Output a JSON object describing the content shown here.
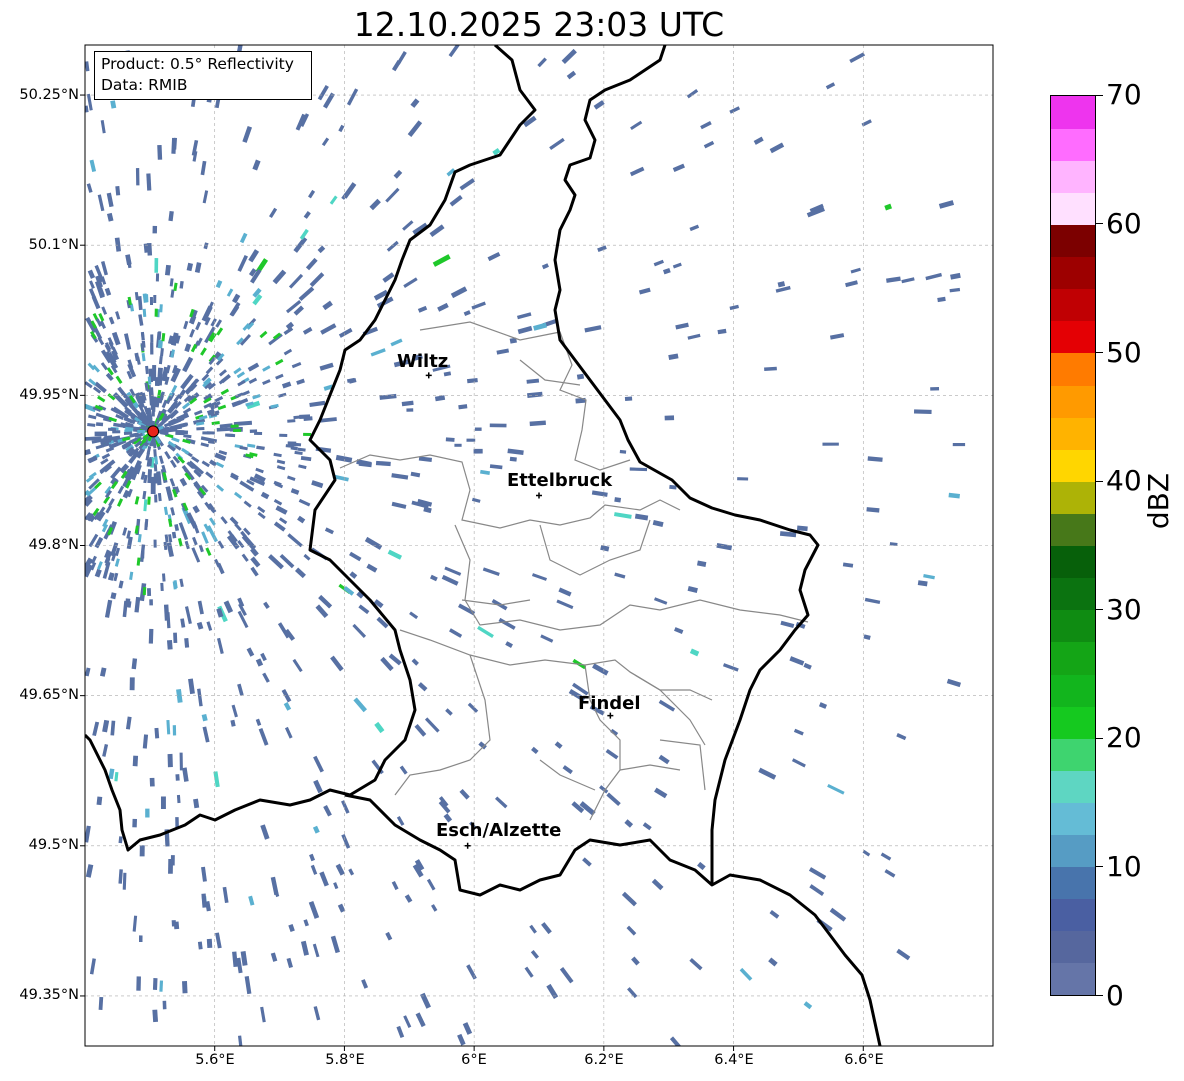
{
  "title": "12.10.2025 23:03 UTC",
  "info_box": {
    "product": "Product: 0.5° Reflectivity",
    "data": "Data: RMIB"
  },
  "lat_labels": [
    "50.25°N",
    "50.1°N",
    "49.95°N",
    "49.8°N",
    "49.65°N",
    "49.5°N",
    "49.35°N"
  ],
  "lon_labels": [
    "5.6°E",
    "5.8°E",
    "6°E",
    "6.2°E",
    "6.4°E",
    "6.6°E"
  ],
  "cities": [
    {
      "name": "Wiltz",
      "lon": 5.93,
      "lat": 49.97
    },
    {
      "name": "Ettelbruck",
      "lon": 6.1,
      "lat": 49.85
    },
    {
      "name": "Findel",
      "lon": 6.21,
      "lat": 49.63
    },
    {
      "name": "Esch/Alzette",
      "lon": 5.99,
      "lat": 49.5
    }
  ],
  "radar_site": {
    "lon": 5.505,
    "lat": 49.914,
    "color": "#e8231b"
  },
  "map_extent": {
    "lon_min": 5.4,
    "lon_max": 6.8,
    "lat_min": 49.3,
    "lat_max": 50.3
  },
  "colorbar": {
    "label": "dBZ",
    "min": 0,
    "max": 70,
    "ticks": [
      "0",
      "10",
      "20",
      "30",
      "40",
      "50",
      "60",
      "70"
    ],
    "colors": [
      "#6575a8",
      "#56679e",
      "#4a5fa2",
      "#4874ac",
      "#569cc4",
      "#64bcd6",
      "#5ed6c2",
      "#3ed46f",
      "#15c91f",
      "#12b51d",
      "#14a516",
      "#0f8c12",
      "#0b7310",
      "#07600a",
      "#477819",
      "#adb306",
      "#ffd600",
      "#ffb300",
      "#ff9a00",
      "#ff7b00",
      "#e40004",
      "#c00003",
      "#9d0000",
      "#7c0000",
      "#ffe0ff",
      "#ffb4ff",
      "#ff6cff",
      "#ee34ee"
    ]
  },
  "echo_colors": {
    "weak": "#5770a3",
    "mid": "#5ab0d0",
    "teal": "#4fd6c4",
    "green": "#1fc82a"
  }
}
